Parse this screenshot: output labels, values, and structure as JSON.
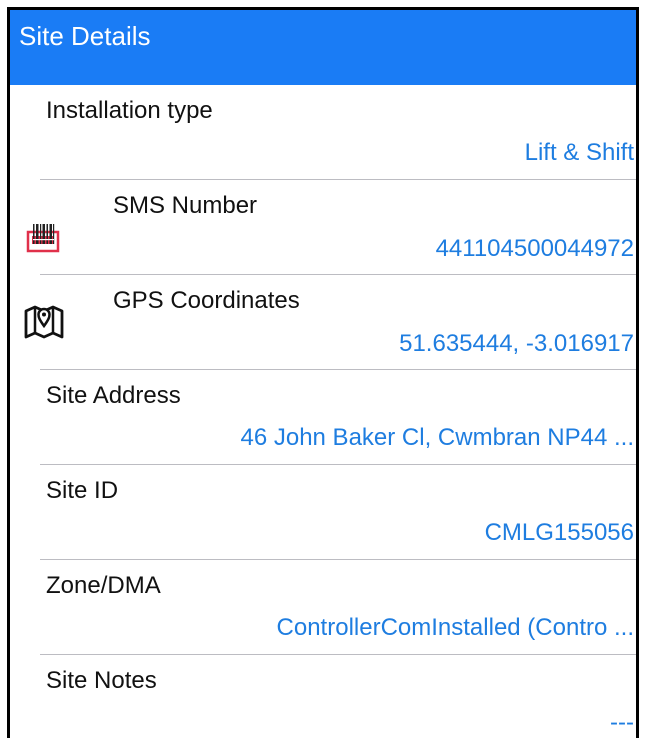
{
  "header": {
    "title": "Site Details"
  },
  "rows": [
    {
      "label": "Installation type",
      "value": "Lift & Shift",
      "icon": ""
    },
    {
      "label": "SMS Number",
      "value": "441104500044972",
      "icon": "sim-barcode-icon"
    },
    {
      "label": "GPS Coordinates",
      "value": "51.635444, -3.016917",
      "icon": "map-pin-icon"
    },
    {
      "label": "Site Address",
      "value": "46 John Baker Cl, Cwmbran NP44 ...",
      "icon": ""
    },
    {
      "label": "Site ID",
      "value": "CMLG155056",
      "icon": ""
    },
    {
      "label": "Zone/DMA",
      "value": "ControllerComInstalled (Contro ...",
      "icon": ""
    },
    {
      "label": "Site Notes",
      "value": "---",
      "icon": ""
    }
  ],
  "colors": {
    "header_bg": "#1a7cf5",
    "value_text": "#1e7de0",
    "divider": "#bcbcc2",
    "sim_icon": "#e0304a"
  }
}
